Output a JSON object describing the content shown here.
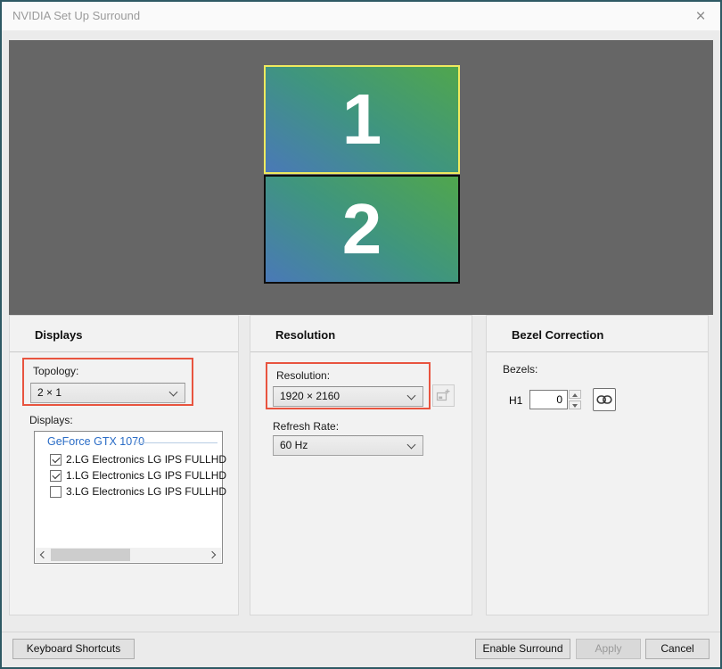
{
  "window": {
    "title": "NVIDIA Set Up Surround",
    "close_label": "×"
  },
  "preview": {
    "monitors": [
      {
        "label": "1",
        "selected": true
      },
      {
        "label": "2",
        "selected": false
      }
    ]
  },
  "panels": {
    "displays": {
      "title": "Displays",
      "topology_label": "Topology:",
      "topology_value": "2 × 1",
      "displays_label": "Displays:",
      "gpu": "GeForce GTX 1070",
      "items": [
        {
          "label": "2.LG Electronics LG IPS FULLHD",
          "checked": true
        },
        {
          "label": "1.LG Electronics LG IPS FULLHD",
          "checked": true
        },
        {
          "label": "3.LG Electronics LG IPS FULLHD",
          "checked": false
        }
      ]
    },
    "resolution": {
      "title": "Resolution",
      "resolution_label": "Resolution:",
      "resolution_value": "1920 × 2160",
      "refresh_label": "Refresh Rate:",
      "refresh_value": "60 Hz"
    },
    "bezel": {
      "title": "Bezel Correction",
      "bezels_label": "Bezels:",
      "h1_label": "H1",
      "h1_value": "0"
    }
  },
  "footer": {
    "keyboard_shortcuts": "Keyboard Shortcuts",
    "enable_surround": "Enable Surround",
    "apply": "Apply",
    "cancel": "Cancel"
  },
  "icons": {
    "close": "close-icon",
    "add_custom_resolution": "add-resolution-icon",
    "link_bezels": "chain-link-icon"
  },
  "colors": {
    "highlight_box": "#e8543f",
    "selected_monitor_border": "#efea5e",
    "gpu_link_text": "#2a6cc6",
    "window_border": "#2e5964",
    "preview_background": "#666666"
  }
}
